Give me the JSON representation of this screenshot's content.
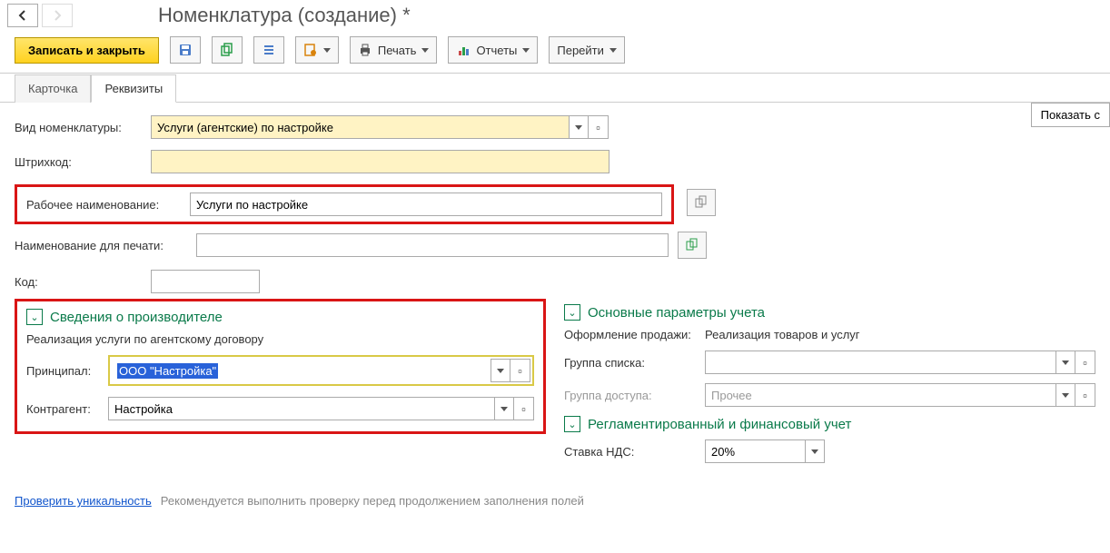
{
  "title": "Номенклатура (создание) *",
  "toolbar": {
    "write_close": "Записать и закрыть",
    "print": "Печать",
    "reports": "Отчеты",
    "goto": "Перейти"
  },
  "tabs": {
    "card": "Карточка",
    "details": "Реквизиты"
  },
  "show_all": "Показать с",
  "fields": {
    "type_label": "Вид номенклатуры:",
    "type_value": "Услуги (агентские) по настройке",
    "barcode_label": "Штрихкод:",
    "workname_label": "Рабочее наименование:",
    "workname_value": "Услуги по настройке",
    "printname_label": "Наименование для печати:",
    "code_label": "Код:"
  },
  "manufacturer": {
    "title": "Сведения о производителе",
    "subtitle": "Реализация услуги по агентскому договору",
    "principal_label": "Принципал:",
    "principal_value": "ООО \"Настройка\"",
    "counterparty_label": "Контрагент:",
    "counterparty_value": "Настройка"
  },
  "accounting": {
    "title": "Основные параметры учета",
    "sale_label": "Оформление продажи:",
    "sale_value": "Реализация товаров и услуг",
    "group_label": "Группа списка:",
    "access_label": "Группа доступа:",
    "access_value": "Прочее"
  },
  "regulated": {
    "title": "Регламентированный и финансовый учет",
    "vat_label": "Ставка НДС:",
    "vat_value": "20%"
  },
  "footer": {
    "check_link": "Проверить уникальность",
    "check_hint": "Рекомендуется выполнить проверку перед продолжением заполнения полей"
  }
}
